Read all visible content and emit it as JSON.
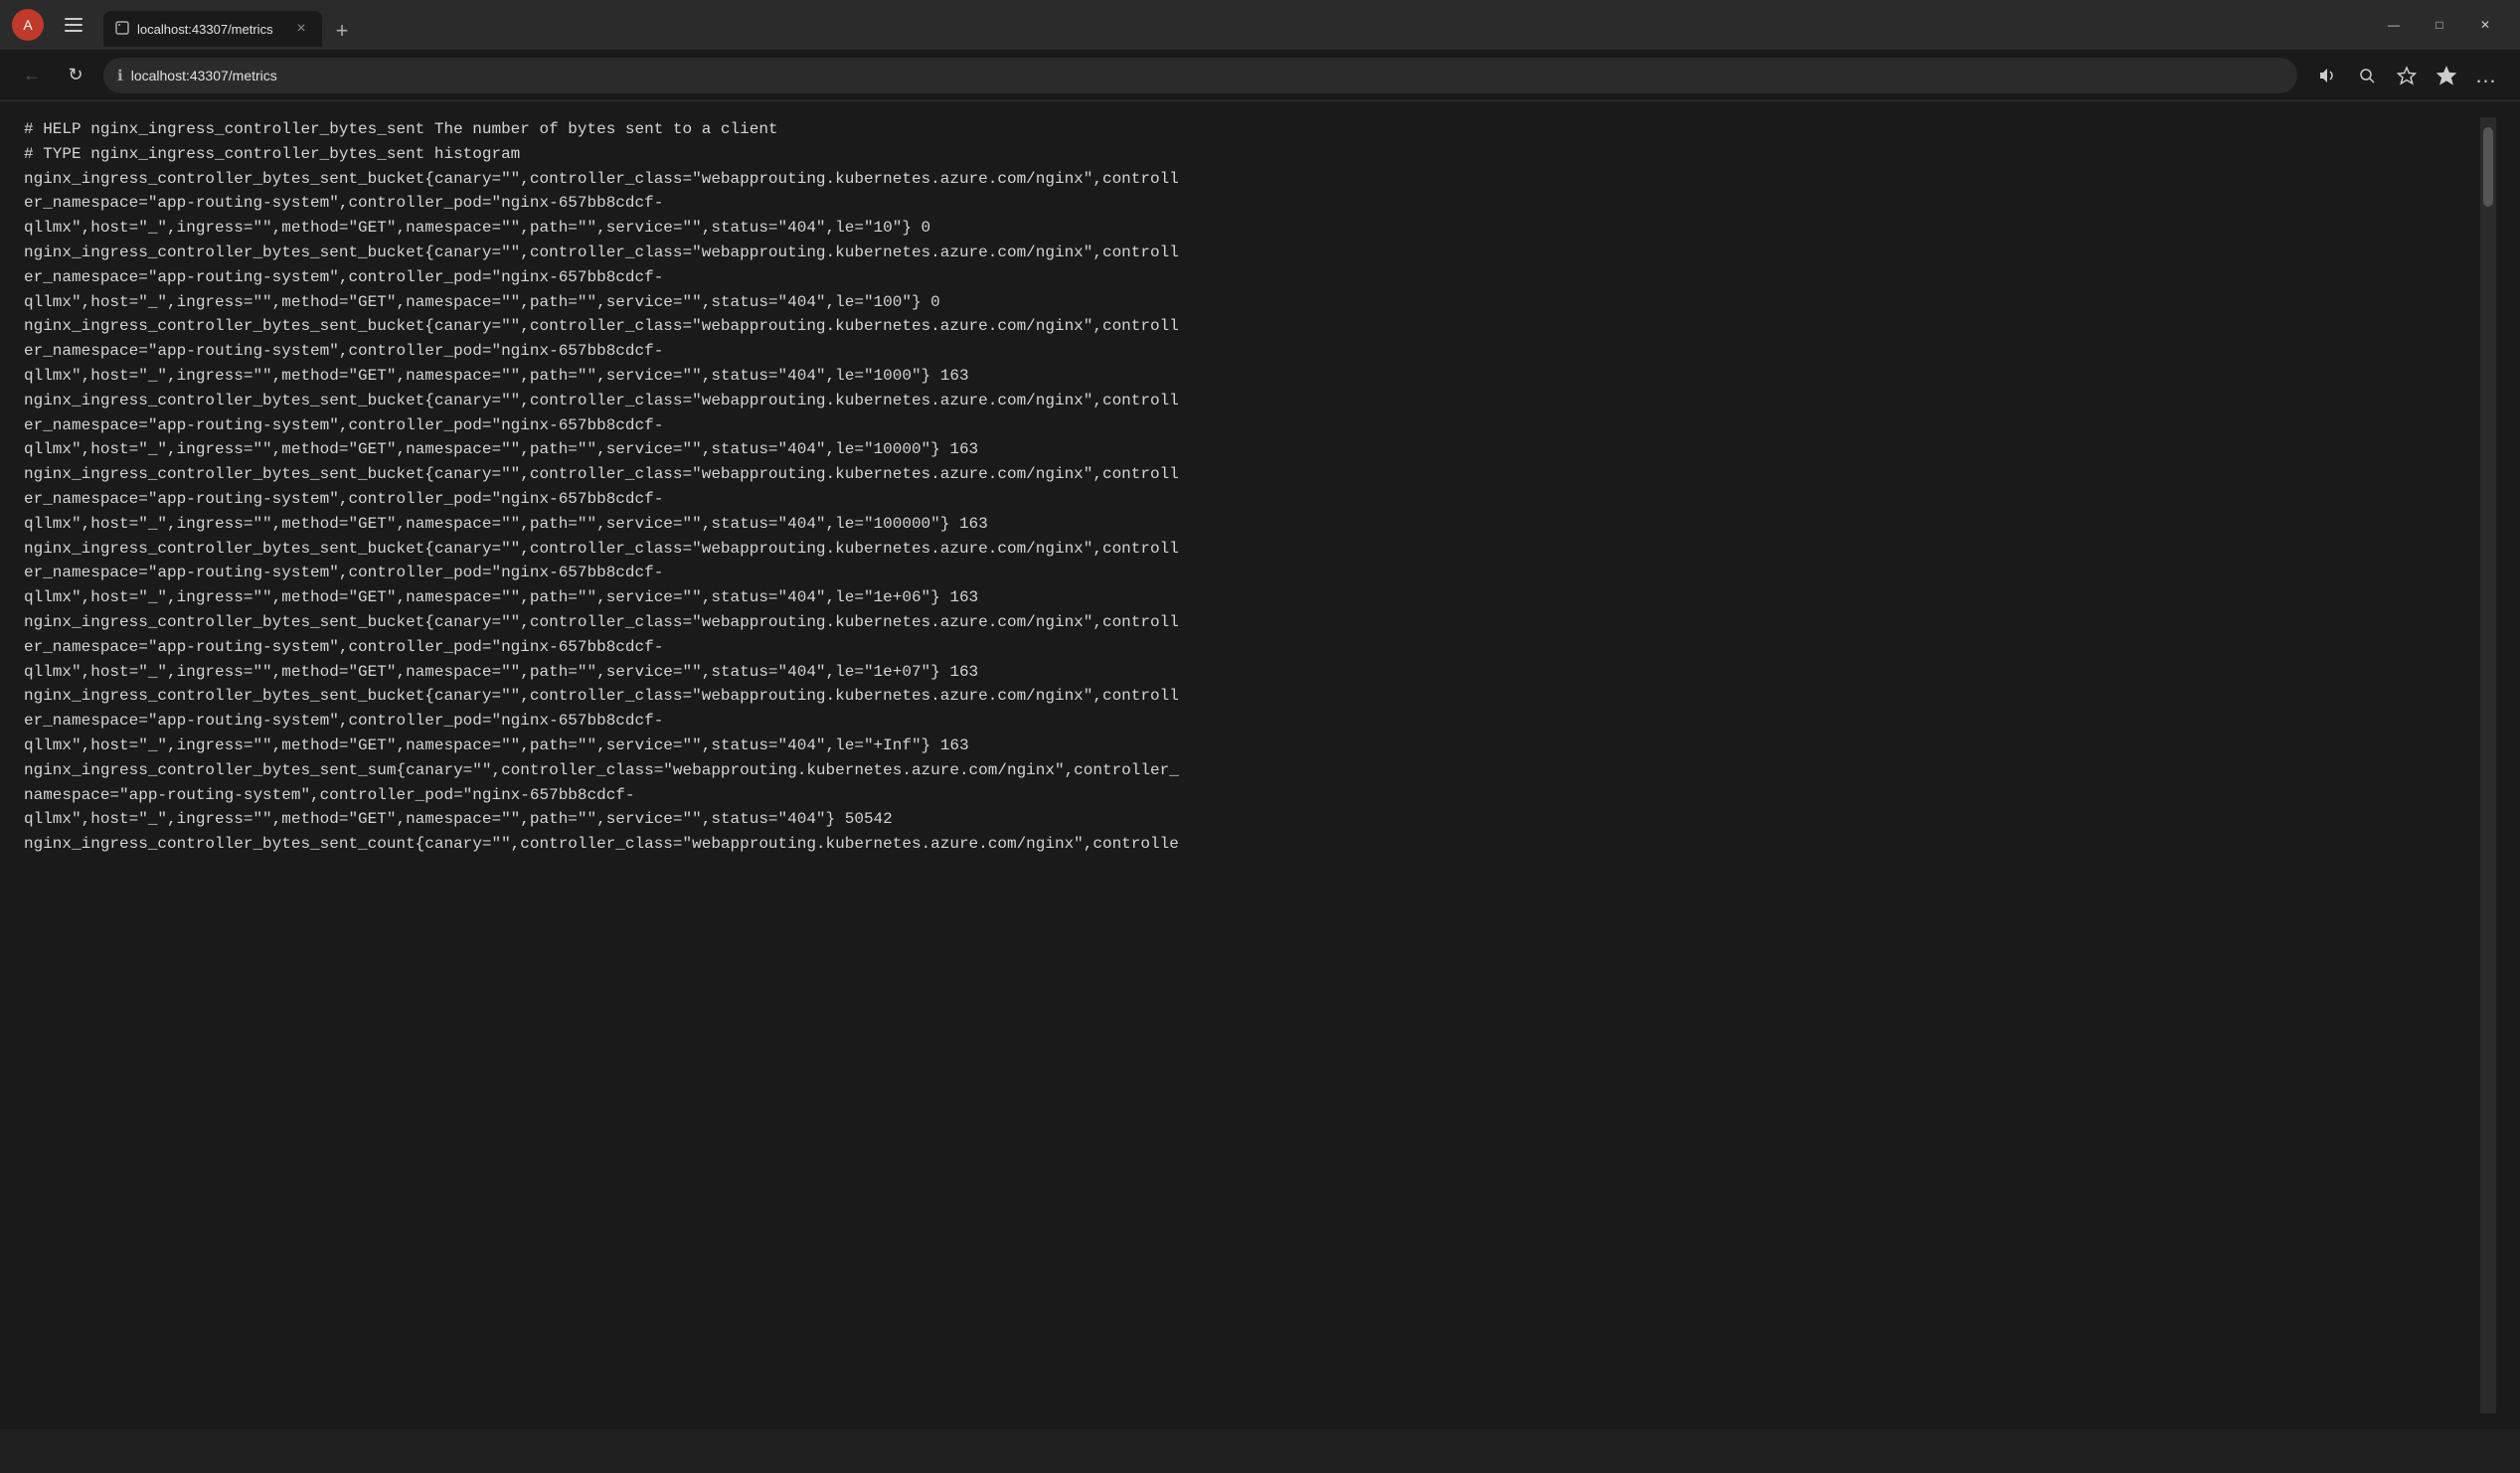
{
  "window": {
    "title": "localhost:43307/metrics",
    "minimize_label": "—",
    "maximize_label": "□",
    "close_label": "✕"
  },
  "titlebar": {
    "avatar_letter": "A",
    "sidebar_icon": "sidebar-icon"
  },
  "tab": {
    "icon": "🔒",
    "title": "localhost:43307/metrics",
    "close_icon": "×",
    "new_tab_icon": "+"
  },
  "addressbar": {
    "back_icon": "←",
    "refresh_icon": "↻",
    "info_icon": "ℹ",
    "url": "localhost:43307/metrics",
    "read_aloud_icon": "🔊",
    "zoom_icon": "🔍",
    "favorites_icon": "☆",
    "collections_icon": "⭐",
    "more_icon": "…"
  },
  "content": {
    "lines": [
      "# HELP nginx_ingress_controller_bytes_sent The number of bytes sent to a client",
      "# TYPE nginx_ingress_controller_bytes_sent histogram",
      "nginx_ingress_controller_bytes_sent_bucket{canary=\"\",controller_class=\"webapprouting.kubernetes.azure.com/nginx\",controll",
      "er_namespace=\"app-routing-system\",controller_pod=\"nginx-657bb8cdcf-",
      "qllmx\",host=\"_\",ingress=\"\",method=\"GET\",namespace=\"\",path=\"\",service=\"\",status=\"404\",le=\"10\"} 0",
      "nginx_ingress_controller_bytes_sent_bucket{canary=\"\",controller_class=\"webapprouting.kubernetes.azure.com/nginx\",controll",
      "er_namespace=\"app-routing-system\",controller_pod=\"nginx-657bb8cdcf-",
      "qllmx\",host=\"_\",ingress=\"\",method=\"GET\",namespace=\"\",path=\"\",service=\"\",status=\"404\",le=\"100\"} 0",
      "nginx_ingress_controller_bytes_sent_bucket{canary=\"\",controller_class=\"webapprouting.kubernetes.azure.com/nginx\",controll",
      "er_namespace=\"app-routing-system\",controller_pod=\"nginx-657bb8cdcf-",
      "qllmx\",host=\"_\",ingress=\"\",method=\"GET\",namespace=\"\",path=\"\",service=\"\",status=\"404\",le=\"1000\"} 163",
      "nginx_ingress_controller_bytes_sent_bucket{canary=\"\",controller_class=\"webapprouting.kubernetes.azure.com/nginx\",controll",
      "er_namespace=\"app-routing-system\",controller_pod=\"nginx-657bb8cdcf-",
      "qllmx\",host=\"_\",ingress=\"\",method=\"GET\",namespace=\"\",path=\"\",service=\"\",status=\"404\",le=\"10000\"} 163",
      "nginx_ingress_controller_bytes_sent_bucket{canary=\"\",controller_class=\"webapprouting.kubernetes.azure.com/nginx\",controll",
      "er_namespace=\"app-routing-system\",controller_pod=\"nginx-657bb8cdcf-",
      "qllmx\",host=\"_\",ingress=\"\",method=\"GET\",namespace=\"\",path=\"\",service=\"\",status=\"404\",le=\"100000\"} 163",
      "nginx_ingress_controller_bytes_sent_bucket{canary=\"\",controller_class=\"webapprouting.kubernetes.azure.com/nginx\",controll",
      "er_namespace=\"app-routing-system\",controller_pod=\"nginx-657bb8cdcf-",
      "qllmx\",host=\"_\",ingress=\"\",method=\"GET\",namespace=\"\",path=\"\",service=\"\",status=\"404\",le=\"1e+06\"} 163",
      "nginx_ingress_controller_bytes_sent_bucket{canary=\"\",controller_class=\"webapprouting.kubernetes.azure.com/nginx\",controll",
      "er_namespace=\"app-routing-system\",controller_pod=\"nginx-657bb8cdcf-",
      "qllmx\",host=\"_\",ingress=\"\",method=\"GET\",namespace=\"\",path=\"\",service=\"\",status=\"404\",le=\"1e+07\"} 163",
      "nginx_ingress_controller_bytes_sent_bucket{canary=\"\",controller_class=\"webapprouting.kubernetes.azure.com/nginx\",controll",
      "er_namespace=\"app-routing-system\",controller_pod=\"nginx-657bb8cdcf-",
      "qllmx\",host=\"_\",ingress=\"\",method=\"GET\",namespace=\"\",path=\"\",service=\"\",status=\"404\",le=\"+Inf\"} 163",
      "nginx_ingress_controller_bytes_sent_sum{canary=\"\",controller_class=\"webapprouting.kubernetes.azure.com/nginx\",controller_",
      "namespace=\"app-routing-system\",controller_pod=\"nginx-657bb8cdcf-",
      "qllmx\",host=\"_\",ingress=\"\",method=\"GET\",namespace=\"\",path=\"\",service=\"\",status=\"404\"} 50542",
      "nginx_ingress_controller_bytes_sent_count{canary=\"\",controller_class=\"webapprouting.kubernetes.azure.com/nginx\",controlle"
    ]
  }
}
